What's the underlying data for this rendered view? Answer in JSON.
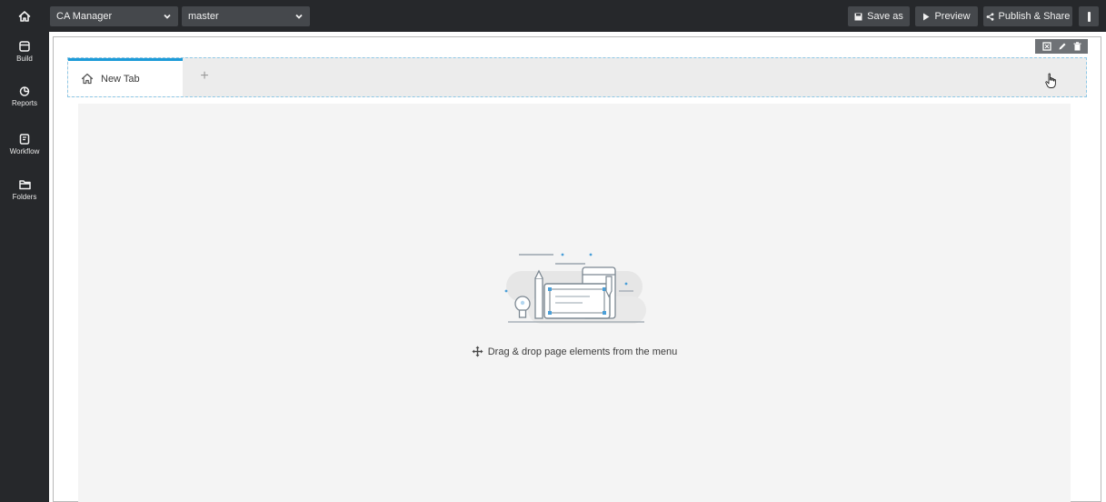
{
  "topbar": {
    "app_selector": {
      "value": "CA Manager"
    },
    "branch_selector": {
      "value": "master"
    },
    "save_label": "Save as",
    "preview_label": "Preview",
    "publish_label": "Publish & Share"
  },
  "sidebar": {
    "items": [
      {
        "label": "Build",
        "icon": "build-icon"
      },
      {
        "label": "Reports",
        "icon": "reports-icon"
      },
      {
        "label": "Workflow",
        "icon": "workflow-icon"
      },
      {
        "label": "Folders",
        "icon": "folder-icon"
      }
    ]
  },
  "canvas": {
    "tabs": [
      {
        "label": "New Tab",
        "icon": "home-icon",
        "active": true
      }
    ],
    "add_tab_label": "+",
    "empty_hint": "Drag & drop page elements from the menu"
  },
  "colors": {
    "topbar_bg": "#26282b",
    "control_bg": "#45484c",
    "accent": "#1d9bd8",
    "dropzone_bg": "#f4f4f4"
  }
}
